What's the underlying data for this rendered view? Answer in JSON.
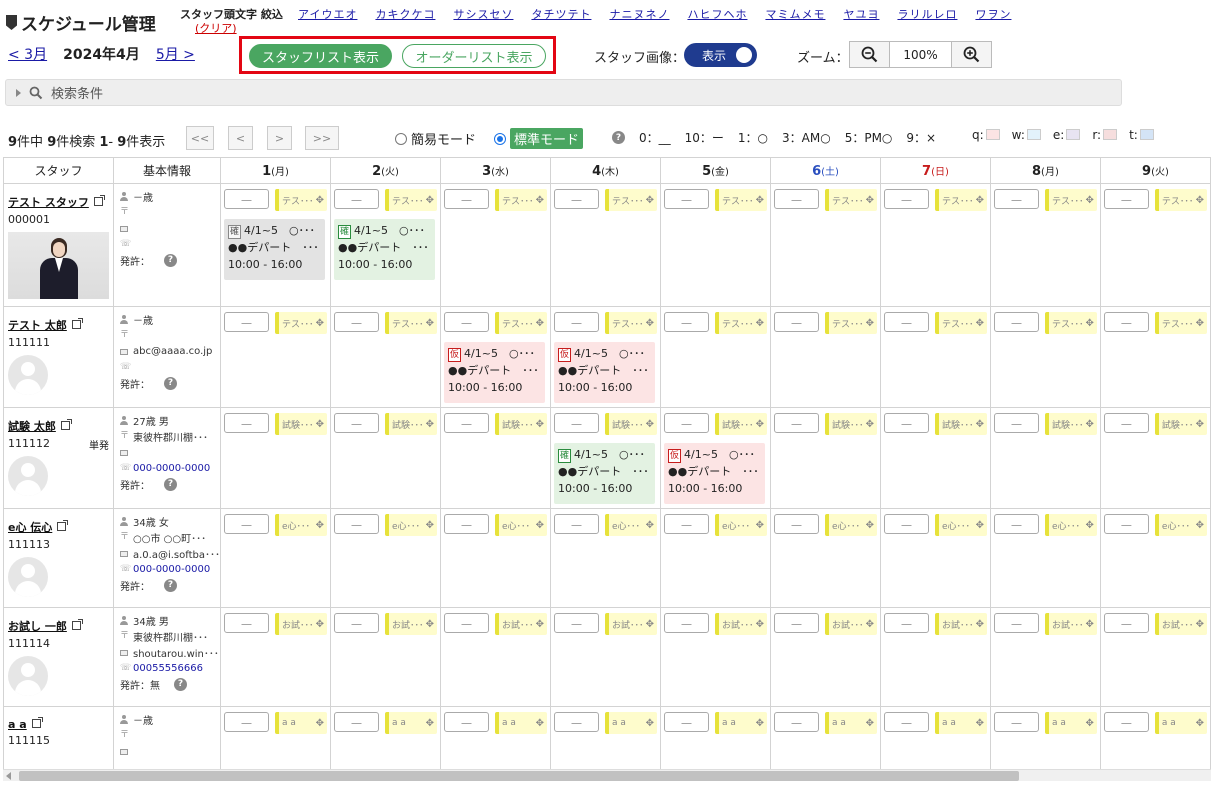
{
  "header": {
    "title": "スケジュール管理",
    "kana_label": "スタッフ頭文字 絞込",
    "kana_clear": "(クリア)",
    "kana_filters": [
      "アイウエオ",
      "カキクケコ",
      "サシスセソ",
      "タチツテト",
      "ナニヌネノ",
      "ハヒフヘホ",
      "マミムメモ",
      "ヤユヨ",
      "ラリルレロ",
      "ワヲン"
    ]
  },
  "month_nav": {
    "prev": "< 3月",
    "current": "2024年4月",
    "next": "5月 >"
  },
  "view_toggle": {
    "staff_list": "スタッフリスト表示",
    "order_list": "オーダーリスト表示"
  },
  "staff_image": {
    "label": "スタッフ画像：",
    "toggle_label": "表示"
  },
  "zoom": {
    "label": "ズーム：",
    "value": "100%"
  },
  "search": {
    "label": "検索条件"
  },
  "results": {
    "total": "9",
    "found": "9",
    "range_start": "1",
    "range_end": "9",
    "t1": "件中 ",
    "t2": "件検索 ",
    "t3": "- ",
    "t4": "件表示"
  },
  "pager": {
    "first": "<<",
    "prev": "<",
    "next": ">",
    "last": ">>"
  },
  "mode": {
    "simple": "簡易モード",
    "standard": "標準モード"
  },
  "legend": [
    "0：__",
    "10：ー",
    "1：○",
    "3：AM○",
    "5：PM○",
    "9：×"
  ],
  "color_legend": [
    {
      "key": "q:",
      "color": "#fce4e4"
    },
    {
      "key": "w:",
      "color": "#e3f2fb"
    },
    {
      "key": "e:",
      "color": "#e8e4f2"
    },
    {
      "key": "r:",
      "color": "#f6dede"
    },
    {
      "key": "t:",
      "color": "#d4e4f6"
    }
  ],
  "columns": {
    "staff": "スタッフ",
    "info": "基本情報"
  },
  "days": [
    {
      "num": "1",
      "wd": "(月)",
      "type": ""
    },
    {
      "num": "2",
      "wd": "(火)",
      "type": ""
    },
    {
      "num": "3",
      "wd": "(水)",
      "type": ""
    },
    {
      "num": "4",
      "wd": "(木)",
      "type": ""
    },
    {
      "num": "5",
      "wd": "(金)",
      "type": ""
    },
    {
      "num": "6",
      "wd": "(土)",
      "type": "sat"
    },
    {
      "num": "7",
      "wd": "(日)",
      "type": "sun"
    },
    {
      "num": "8",
      "wd": "(月)",
      "type": ""
    },
    {
      "num": "9",
      "wd": "(火)",
      "type": ""
    }
  ],
  "day_box_value": "＿",
  "staff": [
    {
      "name": "テスト スタッフ",
      "code": "000001",
      "extra": "",
      "photo": "photo",
      "age": "－歳",
      "address": "",
      "email": "",
      "phone": "",
      "permit": "発許：",
      "tag": "テス･･･",
      "cards": [
        {
          "day": 0,
          "color": "gray",
          "badge": "確",
          "badge_type": "k",
          "line1": "4/1~5　○･･･",
          "line2": "●●デパート　･･･",
          "line3": "10:00 - 16:00"
        },
        {
          "day": 1,
          "color": "green",
          "badge": "確",
          "badge_type": "g",
          "line1": "4/1~5　○･･･",
          "line2": "●●デパート　･･･",
          "line3": "10:00 - 16:00"
        }
      ]
    },
    {
      "name": "テスト 太郎",
      "code": "111111",
      "extra": "",
      "photo": "avatar",
      "age": "－歳",
      "address": "",
      "email": "abc@aaaa.co.jp",
      "phone": "",
      "permit": "発許：",
      "tag": "テス･･･",
      "cards": [
        {
          "day": 2,
          "color": "pink",
          "badge": "仮",
          "badge_type": "r",
          "line1": "4/1~5　○･･･",
          "line2": "●●デパート　･･･",
          "line3": "10:00 - 16:00"
        },
        {
          "day": 3,
          "color": "pink",
          "badge": "仮",
          "badge_type": "r",
          "line1": "4/1~5　○･･･",
          "line2": "●●デパート　･･･",
          "line3": "10:00 - 16:00"
        }
      ]
    },
    {
      "name": "試験 太郎",
      "code": "111112",
      "extra": "単発",
      "photo": "avatar",
      "age": "27歳 男",
      "address": "東彼杵郡川棚･･･",
      "email": "",
      "phone": "000-0000-0000",
      "permit": "発許：",
      "tag": "試験･･･",
      "cards": [
        {
          "day": 3,
          "color": "green",
          "badge": "確",
          "badge_type": "g",
          "line1": "4/1~5　○･･･",
          "line2": "●●デパート　･･･",
          "line3": "10:00 - 16:00"
        },
        {
          "day": 4,
          "color": "pink",
          "badge": "仮",
          "badge_type": "r",
          "line1": "4/1~5　○･･･",
          "line2": "●●デパート　･･･",
          "line3": "10:00 - 16:00"
        }
      ]
    },
    {
      "name": "e心 伝心",
      "code": "111113",
      "extra": "",
      "photo": "avatar",
      "age": "34歳 女",
      "address": "○○市 ○○町･･･",
      "email": "a.0.a@i.softba･･･",
      "phone": "000-0000-0000",
      "permit": "発許：",
      "tag": "e心･･･",
      "cards": []
    },
    {
      "name": "お試し 一郎",
      "code": "111114",
      "extra": "",
      "photo": "avatar",
      "age": "34歳 男",
      "address": "東彼杵郡川棚･･･",
      "email": "shoutarou.win･･･",
      "phone": "00055556666",
      "permit": "発許：無",
      "tag": "お試･･･",
      "cards": []
    },
    {
      "name": "a a",
      "code": "111115",
      "extra": "",
      "photo": "none",
      "age": "－歳",
      "address": "",
      "email": "",
      "phone": "",
      "permit": "",
      "tag": "a a",
      "cards": []
    }
  ]
}
